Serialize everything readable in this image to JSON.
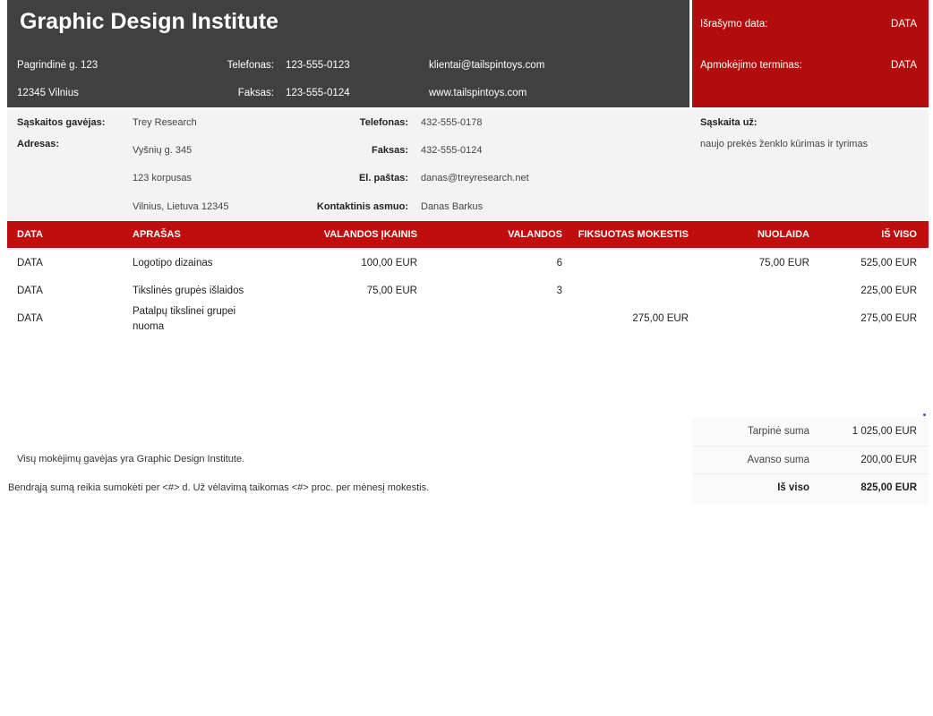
{
  "header": {
    "company": "Graphic Design Institute",
    "address1": "Pagrindinė g. 123",
    "address2": "12345 Vilnius",
    "phone_label": "Telefonas:",
    "phone": "123-555-0123",
    "fax_label": "Faksas:",
    "fax": "123-555-0124",
    "email": "klientai@tailspintoys.com",
    "website": "www.tailspintoys.com",
    "issue_date_label": "Išrašymo data:",
    "issue_date": "DATA",
    "due_label": "Apmokėjimo terminas:",
    "due": "DATA"
  },
  "bill_to": {
    "recipient_label": "Sąskaitos gavėjas:",
    "recipient": "Trey Research",
    "address_label": "Adresas:",
    "street": "Vyšnių g. 345",
    "suite": "123 korpusas",
    "city": "Vilnius, Lietuva 12345",
    "phone_label": "Telefonas:",
    "phone": "432-555-0178",
    "fax_label": "Faksas:",
    "fax": "432-555-0124",
    "email_label": "El. paštas:",
    "email": "danas@treyresearch.net",
    "contact_label": "Kontaktinis asmuo:",
    "contact": "Danas Barkus",
    "invoice_for_label": "Sąskaita už:",
    "invoice_for": "naujo prekės ženklo kūrimas ir tyrimas"
  },
  "table": {
    "headers": [
      "DATA",
      "APRAŠAS",
      "VALANDOS ĮKAINIS",
      "VALANDOS",
      "FIKSUOTAS MOKESTIS",
      "NUOLAIDA",
      "IŠ VISO"
    ],
    "rows": [
      {
        "date": "DATA",
        "desc1": "Logotipo dizainas",
        "desc2": "",
        "rate": "100,00 EUR",
        "hours": "6",
        "fixed": "",
        "discount": "75,00 EUR",
        "total": "525,00 EUR"
      },
      {
        "date": "DATA",
        "desc1": "Tikslinės grupės išlaidos",
        "desc2": "",
        "rate": "75,00 EUR",
        "hours": "3",
        "fixed": "",
        "discount": "",
        "total": "225,00 EUR"
      },
      {
        "date": "DATA",
        "desc1": "Patalpų tikslinei grupei",
        "desc2": "nuoma",
        "rate": "",
        "hours": "",
        "fixed": "275,00 EUR",
        "discount": "",
        "total": "275,00 EUR"
      }
    ]
  },
  "summary": {
    "subtotal_label": "Tarpinė suma",
    "subtotal": "1 025,00 EUR",
    "advance_label": "Avanso suma",
    "advance": "200,00 EUR",
    "total_label": "Iš viso",
    "total": "825,00 EUR"
  },
  "notes": {
    "payee": "Visų mokėjimų gavėjas yra Graphic Design Institute.",
    "terms": "Bendrąją sumą reikia sumokėti per <#> d. Už vėlavimą taikomas <#> proc. per mėnesį mokestis."
  },
  "colors": {
    "header_dark": "#404040",
    "accent_red": "#c00d0d",
    "light_panel": "#f3f3f3"
  }
}
